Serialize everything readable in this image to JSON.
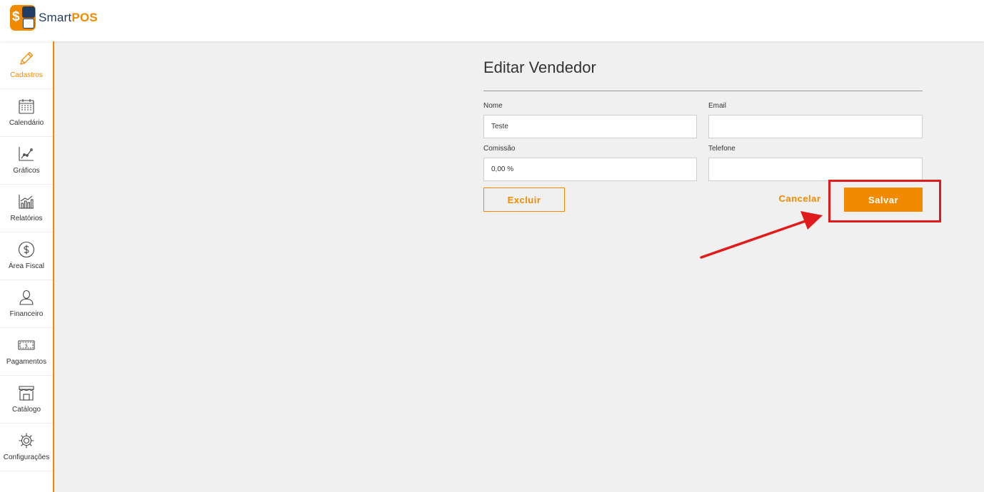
{
  "brand": {
    "name_prefix": "Smart",
    "name_suffix": "POS",
    "icon": "smartpos-logo",
    "accent": "#f28a00",
    "dark": "#1f3d63"
  },
  "sidebar": {
    "items": [
      {
        "label": "Cadastros",
        "icon": "pencil-icon",
        "active": true
      },
      {
        "label": "Calendário",
        "icon": "calendar-icon"
      },
      {
        "label": "Gráficos",
        "icon": "line-chart-icon"
      },
      {
        "label": "Relatórios",
        "icon": "bar-chart-icon"
      },
      {
        "label": "Área Fiscal",
        "icon": "dollar-circle-icon"
      },
      {
        "label": "Financeiro",
        "icon": "user-icon"
      },
      {
        "label": "Pagamentos",
        "icon": "banknote-icon"
      },
      {
        "label": "Catálogo",
        "icon": "store-icon"
      },
      {
        "label": "Configurações",
        "icon": "gear-icon"
      }
    ]
  },
  "form": {
    "title": "Editar Vendedor",
    "nome": {
      "label": "Nome",
      "value": "Teste"
    },
    "email": {
      "label": "Email",
      "value": ""
    },
    "comissao": {
      "label": "Comissão",
      "value": "0,00 %"
    },
    "telefone": {
      "label": "Telefone",
      "value": ""
    }
  },
  "actions": {
    "delete_label": "Excluir",
    "cancel_label": "Cancelar",
    "save_label": "Salvar"
  },
  "annotation": {
    "color": "#e11b1b"
  }
}
